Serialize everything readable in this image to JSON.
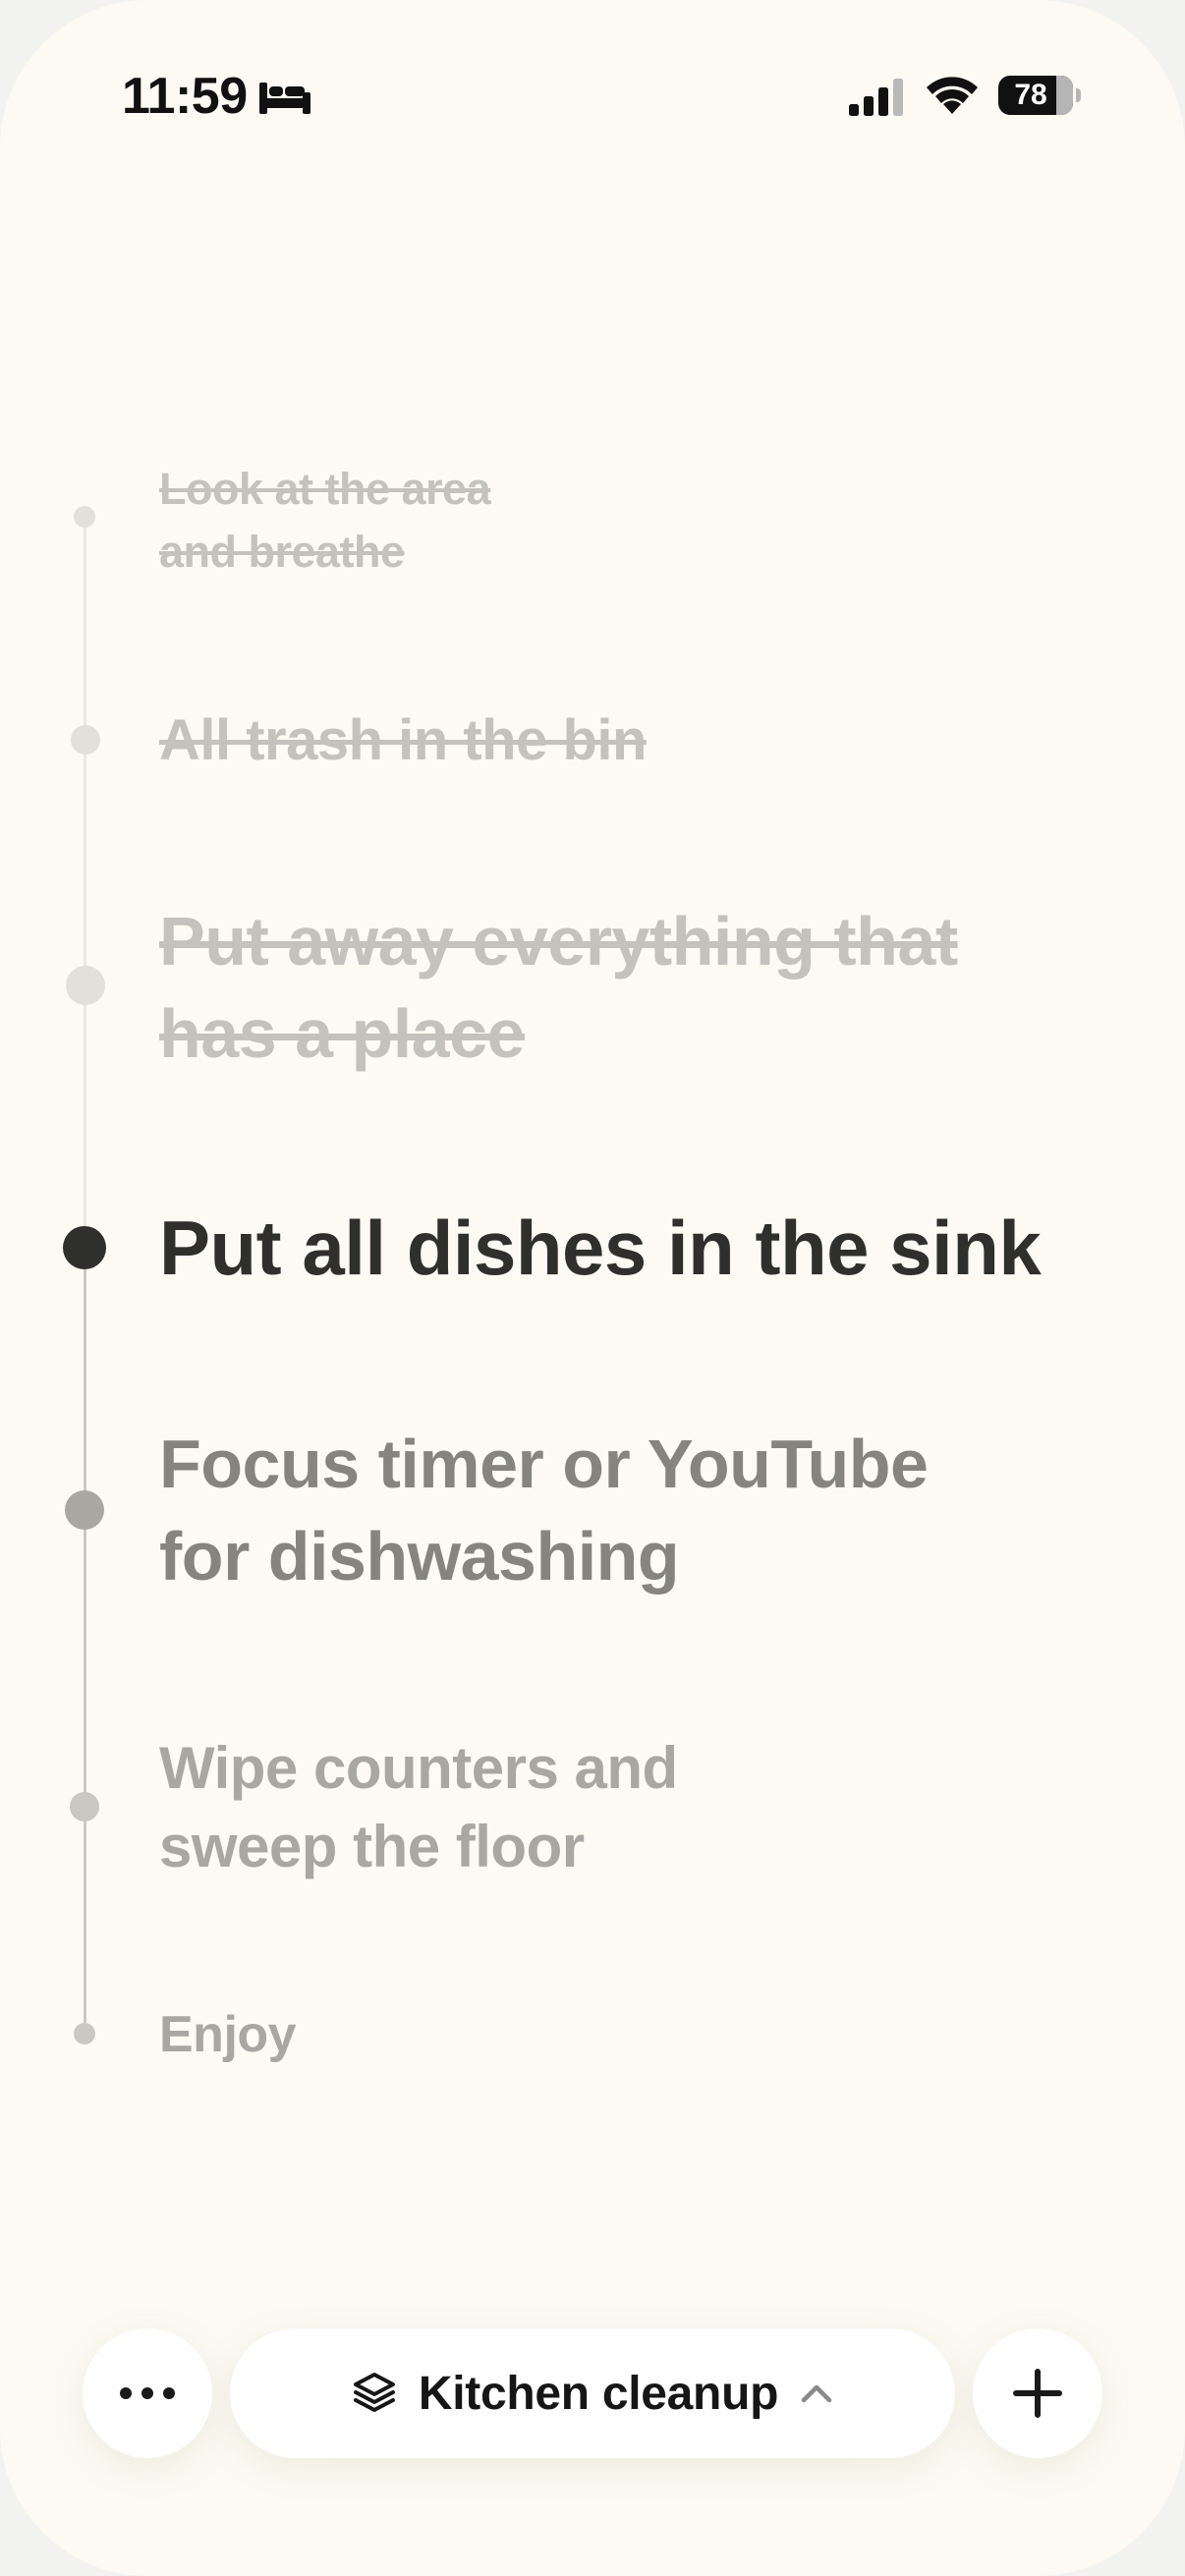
{
  "status_bar": {
    "time": "11:59",
    "battery_level": 78,
    "battery_text": "78",
    "icons": [
      "bed-icon",
      "cellular-signal-icon",
      "wifi-icon",
      "battery-icon"
    ]
  },
  "steps": [
    {
      "line1": "Look at the area",
      "line2": "and breathe",
      "state": "done"
    },
    {
      "line1": "All trash in the bin",
      "line2": "",
      "state": "done"
    },
    {
      "line1": "Put away everything that",
      "line2": "has a place",
      "state": "done"
    },
    {
      "line1": "Put all dishes in the sink",
      "line2": "",
      "state": "current"
    },
    {
      "line1": "Focus timer or YouTube",
      "line2": "for dishwashing",
      "state": "next"
    },
    {
      "line1": "Wipe counters and",
      "line2": "sweep the floor",
      "state": "upcoming"
    },
    {
      "line1": "Enjoy",
      "line2": "",
      "state": "upcoming"
    }
  ],
  "bottom_bar": {
    "project_label": "Kitchen cleanup",
    "icons": {
      "more": "more-horizontal-icon",
      "project": "layers-icon",
      "chevron": "chevron-up-icon",
      "add": "plus-icon"
    }
  },
  "colors": {
    "background": "#fcfaf2",
    "text_done": "#c4c2bd",
    "text_current": "#2f2f2c",
    "text_next": "#86847f",
    "text_upcoming": "#a9a7a2"
  }
}
